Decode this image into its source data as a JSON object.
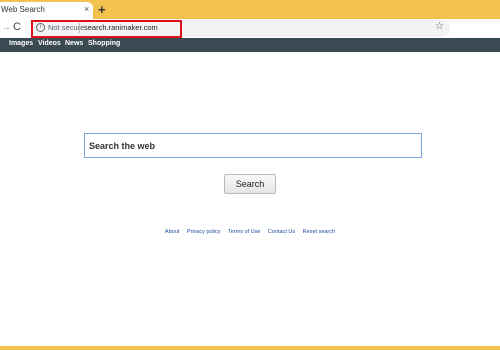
{
  "tab": {
    "title": "Web Search",
    "close": "×"
  },
  "new_tab": "+",
  "toolbar": {
    "forward": "→",
    "reload": "C",
    "security_label": "Not secure",
    "url": "search.ranimaker.com",
    "star": "☆"
  },
  "navbar": {
    "items": [
      "Images",
      "Videos",
      "News",
      "Shopping"
    ]
  },
  "search": {
    "placeholder": "Search the web",
    "button_label": "Search"
  },
  "footer": {
    "links": [
      "About",
      "Privacy policy",
      "Terms of Use",
      "Contact Us",
      "Reset search"
    ]
  },
  "colors": {
    "tab_strip": "#f2c14e",
    "navbar": "#3a4a52",
    "highlight": "#e0101a",
    "link": "#1a4b9b"
  }
}
